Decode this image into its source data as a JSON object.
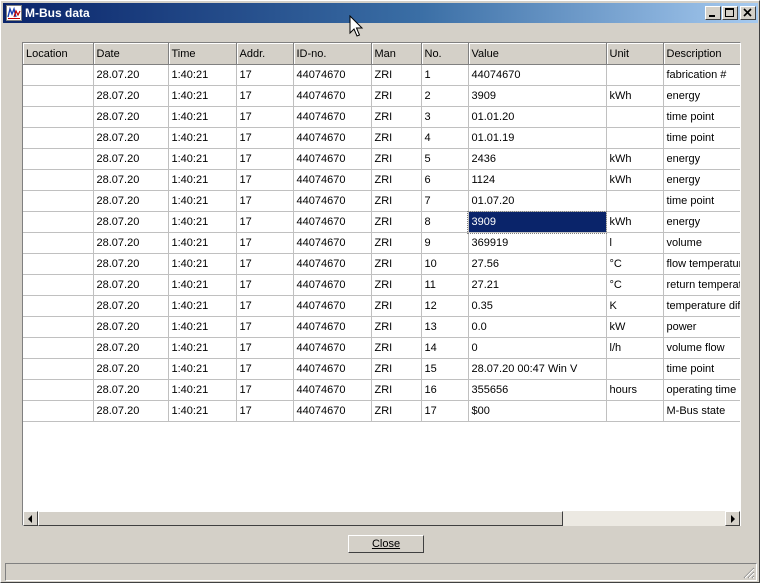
{
  "window": {
    "title": "M-Bus data"
  },
  "table": {
    "columns": [
      "Location",
      "Date",
      "Time",
      "Addr.",
      "ID-no.",
      "Man",
      "No.",
      "Value",
      "Unit",
      "Description"
    ],
    "rows": [
      [
        "",
        "28.07.20",
        "1:40:21",
        "17",
        "44074670",
        "ZRI",
        "1",
        "44074670",
        "",
        "fabrication #"
      ],
      [
        "",
        "28.07.20",
        "1:40:21",
        "17",
        "44074670",
        "ZRI",
        "2",
        "3909",
        "kWh",
        "energy"
      ],
      [
        "",
        "28.07.20",
        "1:40:21",
        "17",
        "44074670",
        "ZRI",
        "3",
        "01.01.20",
        "",
        "time point"
      ],
      [
        "",
        "28.07.20",
        "1:40:21",
        "17",
        "44074670",
        "ZRI",
        "4",
        "01.01.19",
        "",
        "time point"
      ],
      [
        "",
        "28.07.20",
        "1:40:21",
        "17",
        "44074670",
        "ZRI",
        "5",
        "2436",
        "kWh",
        "energy"
      ],
      [
        "",
        "28.07.20",
        "1:40:21",
        "17",
        "44074670",
        "ZRI",
        "6",
        "1124",
        "kWh",
        "energy"
      ],
      [
        "",
        "28.07.20",
        "1:40:21",
        "17",
        "44074670",
        "ZRI",
        "7",
        "01.07.20",
        "",
        "time point"
      ],
      [
        "",
        "28.07.20",
        "1:40:21",
        "17",
        "44074670",
        "ZRI",
        "8",
        "3909",
        "kWh",
        "energy"
      ],
      [
        "",
        "28.07.20",
        "1:40:21",
        "17",
        "44074670",
        "ZRI",
        "9",
        "369919",
        "l",
        "volume"
      ],
      [
        "",
        "28.07.20",
        "1:40:21",
        "17",
        "44074670",
        "ZRI",
        "10",
        "27.56",
        "°C",
        "flow temperature"
      ],
      [
        "",
        "28.07.20",
        "1:40:21",
        "17",
        "44074670",
        "ZRI",
        "11",
        "27.21",
        "°C",
        "return temperature"
      ],
      [
        "",
        "28.07.20",
        "1:40:21",
        "17",
        "44074670",
        "ZRI",
        "12",
        "0.35",
        "K",
        "temperature difference"
      ],
      [
        "",
        "28.07.20",
        "1:40:21",
        "17",
        "44074670",
        "ZRI",
        "13",
        "0.0",
        "kW",
        "power"
      ],
      [
        "",
        "28.07.20",
        "1:40:21",
        "17",
        "44074670",
        "ZRI",
        "14",
        "0",
        "l/h",
        "volume flow"
      ],
      [
        "",
        "28.07.20",
        "1:40:21",
        "17",
        "44074670",
        "ZRI",
        "15",
        "28.07.20 00:47 Win  V",
        "",
        "time point"
      ],
      [
        "",
        "28.07.20",
        "1:40:21",
        "17",
        "44074670",
        "ZRI",
        "16",
        "355656",
        "hours",
        "operating time"
      ],
      [
        "",
        "28.07.20",
        "1:40:21",
        "17",
        "44074670",
        "ZRI",
        "17",
        "$00",
        "",
        "M-Bus state"
      ]
    ],
    "selected_cell": {
      "row": 8,
      "column": "Value"
    }
  },
  "buttons": {
    "close": "Close"
  },
  "icons": {
    "app": "m-bus-app-icon",
    "minimize": "minimize-icon",
    "maximize": "maximize-icon",
    "close": "close-icon",
    "cursor": "mouse-pointer-icon",
    "scroll_left": "scroll-left-icon",
    "scroll_right": "scroll-right-icon",
    "grip": "resize-grip-icon"
  },
  "colors": {
    "titlebar_start": "#0a246a",
    "titlebar_end": "#a6caf0",
    "selection": "#0a246a",
    "window_bg": "#d4d0c8"
  }
}
